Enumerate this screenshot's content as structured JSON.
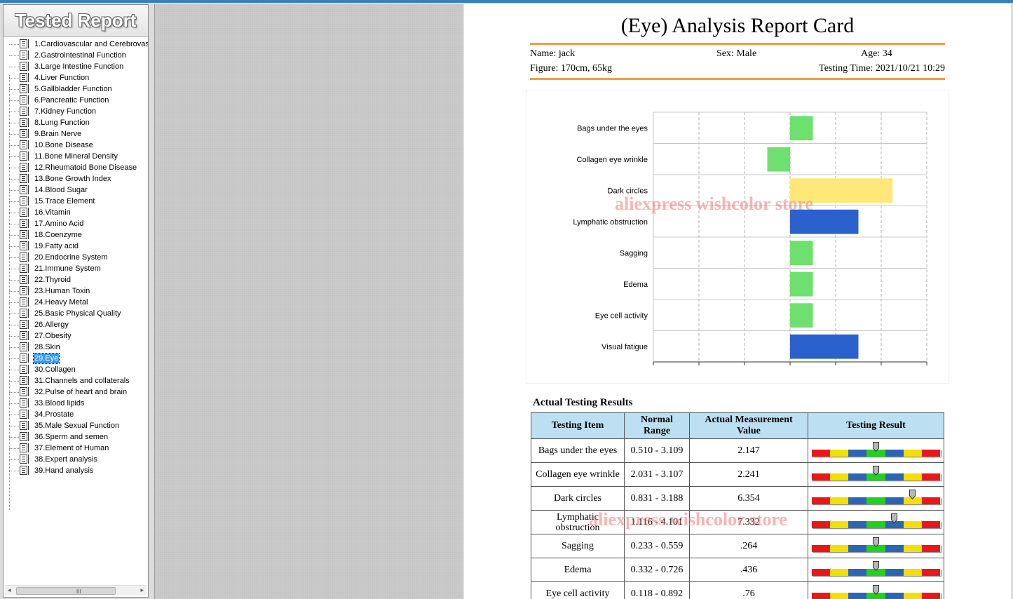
{
  "sidebar": {
    "title": "Tested Report",
    "items": [
      "1.Cardiovascular and Cerebrovas",
      "2.Gastrointestinal Function",
      "3.Large Intestine Function",
      "4.Liver Function",
      "5.Gallbladder Function",
      "6.Pancreatic Function",
      "7.Kidney Function",
      "8.Lung Function",
      "9.Brain Nerve",
      "10.Bone Disease",
      "11.Bone Mineral Density",
      "12.Rheumatoid Bone Disease",
      "13.Bone Growth Index",
      "14.Blood Sugar",
      "15.Trace Element",
      "16.Vitamin",
      "17.Amino Acid",
      "18.Coenzyme",
      "19.Fatty acid",
      "20.Endocrine System",
      "21.Immune System",
      "22.Thyroid",
      "23.Human Toxin",
      "24.Heavy Metal",
      "25.Basic Physical Quality",
      "26.Allergy",
      "27.Obesity",
      "28.Skin",
      "29.Eye",
      "30.Collagen",
      "31.Channels and collaterals",
      "32.Pulse of heart and brain",
      "33.Blood lipids",
      "34.Prostate",
      "35.Male Sexual Function",
      "36.Sperm and semen",
      "37.Element of Human",
      "38.Expert analysis",
      "39.Hand analysis"
    ],
    "selected_index": 28,
    "scroll_grip": "III"
  },
  "report": {
    "title": "(Eye) Analysis Report Card",
    "name": "Name: jack",
    "sex": "Sex: Male",
    "age": "Age: 34",
    "figure": "Figure: 170cm, 65kg",
    "testing_time": "Testing Time: 2021/10/21 10:29",
    "watermark": "aliexpress wishcolor store",
    "section_title": "Actual Testing Results",
    "table": {
      "headers": [
        "Testing Item",
        "Normal Range",
        "Actual Measurement Value",
        "Testing Result"
      ],
      "rows": [
        {
          "item": "Bags under the eyes",
          "range": "0.510 - 3.109",
          "value": "2.147",
          "level": 0.5
        },
        {
          "item": "Collagen eye wrinkle",
          "range": "2.031 - 3.107",
          "value": "2.241",
          "level": 0.5
        },
        {
          "item": "Dark circles",
          "range": "0.831 - 3.188",
          "value": "6.354",
          "level": 0.78
        },
        {
          "item": "Lymphatic obstruction",
          "range": "1.116 - 4.101",
          "value": "7.332",
          "level": 0.64
        },
        {
          "item": "Sagging",
          "range": "0.233 - 0.559",
          "value": ".264",
          "level": 0.5
        },
        {
          "item": "Edema",
          "range": "0.332 - 0.726",
          "value": ".436",
          "level": 0.5
        },
        {
          "item": "Eye cell activity",
          "range": "0.118 - 0.892",
          "value": ".76",
          "level": 0.5
        }
      ],
      "meter_colors": [
        "#e81818",
        "#f2e000",
        "#2e64b4",
        "#22d022",
        "#2e64b4",
        "#f2e000",
        "#e81818"
      ]
    }
  },
  "chart_data": {
    "type": "bar",
    "orientation": "horizontal",
    "categories": [
      "Bags under the eyes",
      "Collagen eye wrinkle",
      "Dark circles",
      "Lymphatic obstruction",
      "Sagging",
      "Edema",
      "Eye cell activity",
      "Visual fatigue"
    ],
    "values": [
      1,
      -1,
      4.5,
      3,
      1,
      1,
      1,
      3
    ],
    "colors": [
      "#6ee06e",
      "#6ee06e",
      "#ffe87a",
      "#2b61cc",
      "#6ee06e",
      "#6ee06e",
      "#6ee06e",
      "#2b61cc"
    ],
    "xlim": [
      -6,
      6
    ],
    "grid": true,
    "title": "",
    "xlabel": "",
    "ylabel": ""
  }
}
